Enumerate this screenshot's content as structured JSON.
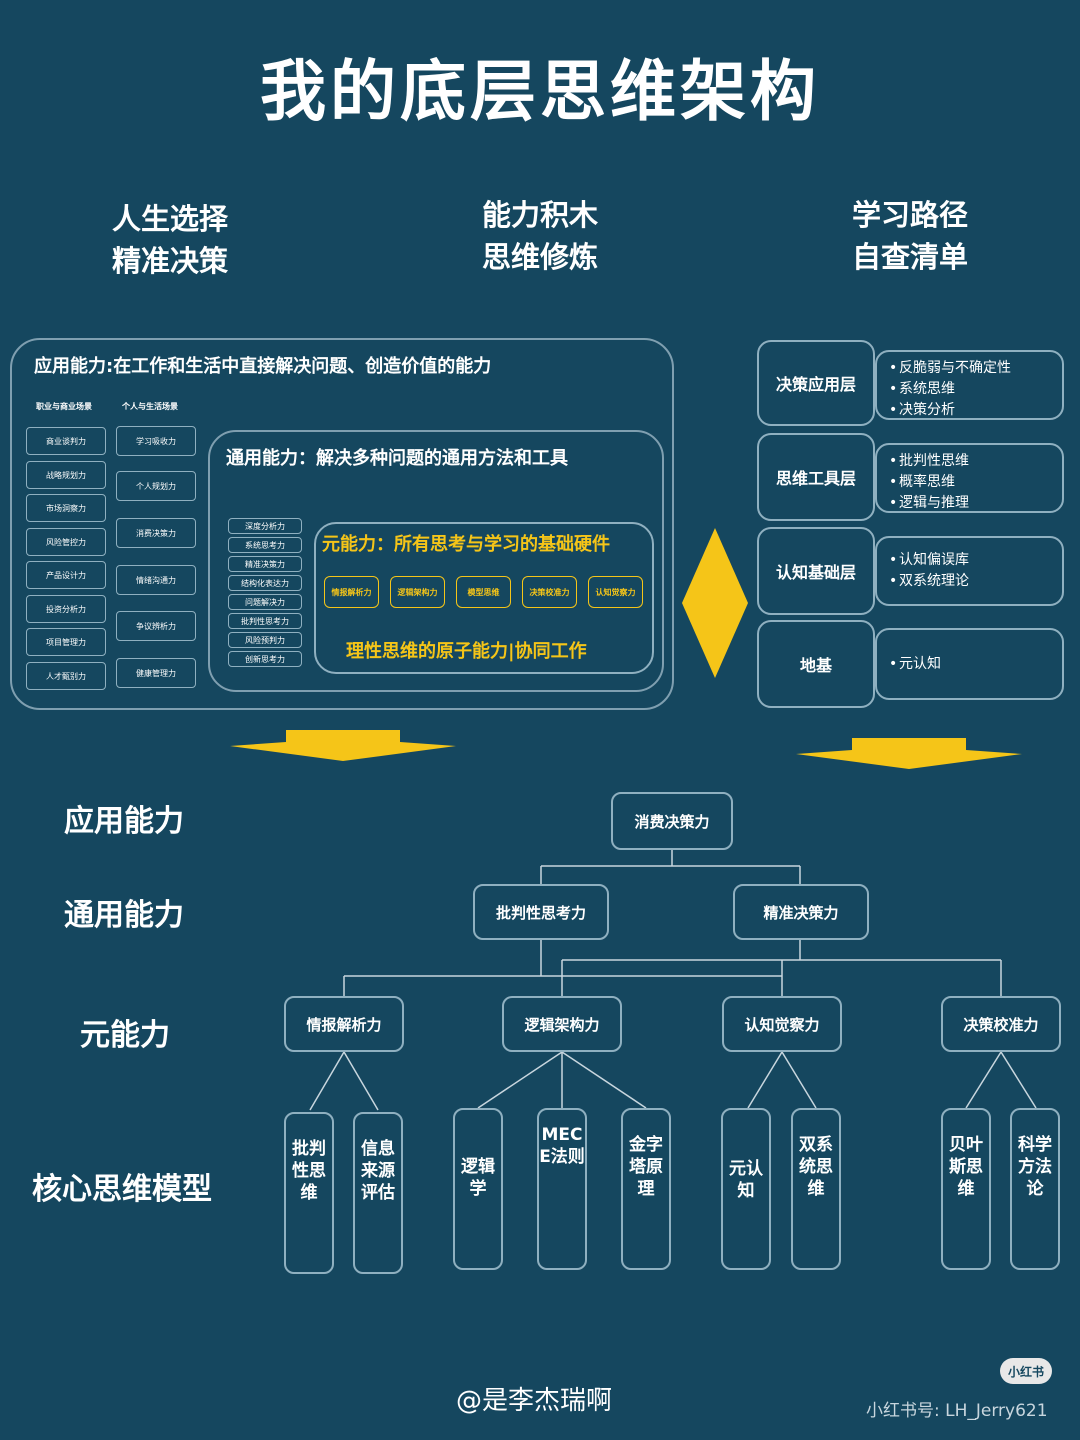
{
  "title": "我的底层思维架构",
  "columns": {
    "left": [
      "人生选择",
      "精准决策"
    ],
    "middle": [
      "能力积木",
      "思维修炼"
    ],
    "right": [
      "学习路径",
      "自查清单"
    ]
  },
  "apply_panel": {
    "title": "应用能力:在工作和生活中直接解决问题、创造价值的能力",
    "career_heading": "职业与商业场景",
    "personal_heading": "个人与生活场景",
    "career_items": [
      "商业谈判力",
      "战略规划力",
      "市场洞察力",
      "风险管控力",
      "产品设计力",
      "投资分析力",
      "项目管理力",
      "人才甄别力"
    ],
    "personal_items": [
      "学习吸收力",
      "个人规划力",
      "消费决策力",
      "情绪沟通力",
      "争议辨析力",
      "健康管理力"
    ]
  },
  "general_panel": {
    "title": "通用能力：解决多种问题的通用方法和工具",
    "items": [
      "深度分析力",
      "系统思考力",
      "精准决策力",
      "结构化表达力",
      "问题解决力",
      "批判性思考力",
      "风险预判力",
      "创新思考力"
    ]
  },
  "meta_panel": {
    "title": "元能力：所有思考与学习的基础硬件",
    "items": [
      "情报解析力",
      "逻辑架构力",
      "模型思维",
      "决策校准力",
      "认知觉察力"
    ],
    "footer": "理性思维的原子能力|协同工作"
  },
  "layers": [
    {
      "name": "决策应用层",
      "details": [
        "反脆弱与不确定性",
        "系统思维",
        "决策分析"
      ]
    },
    {
      "name": "思维工具层",
      "details": [
        "批判性思维",
        "概率思维",
        "逻辑与推理"
      ]
    },
    {
      "name": "认知基础层",
      "details": [
        "认知偏误库",
        "双系统理论"
      ]
    },
    {
      "name": "地基",
      "details": [
        "元认知"
      ]
    }
  ],
  "levels": [
    "应用能力",
    "通用能力",
    "元能力",
    "核心思维模型"
  ],
  "tree": {
    "root": "消费决策力",
    "general": [
      "批判性思考力",
      "精准决策力"
    ],
    "meta": [
      "情报解析力",
      "逻辑架构力",
      "认知觉察力",
      "决策校准力"
    ],
    "models": [
      "批判性思维",
      "信息来源评估",
      "逻辑学",
      "MECE法则",
      "金字塔原理",
      "元认知",
      "双系统思维",
      "贝叶斯思维",
      "科学方法论"
    ]
  },
  "footer": {
    "author": "@是李杰瑞啊",
    "logo": "小红书",
    "account": "小红书号: LH_Jerry621"
  },
  "colors": {
    "background": "#15475f",
    "accent": "#f5c518",
    "border": "#8fb0c0"
  }
}
